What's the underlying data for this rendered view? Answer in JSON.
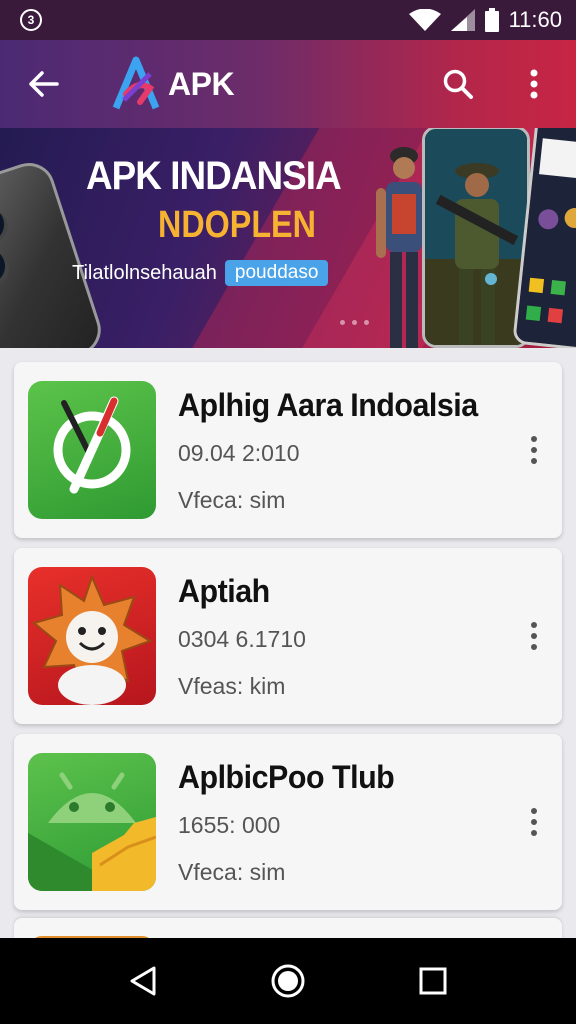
{
  "status_bar": {
    "time": "11:60",
    "notification_badge": "3"
  },
  "header": {
    "logo_text": "APK"
  },
  "banner": {
    "title": "APK INDANSIA",
    "subtitle": "NDOPLEN",
    "tagline": "Tilatlolnsehauah",
    "pill": "pouddaso"
  },
  "apps": [
    {
      "name": "Aplhig Aara Indoalsia",
      "meta": "09.04  2:010",
      "version": "Vfeca: sim",
      "icon": "pencil-circle-icon",
      "icon_color": "#3fae3a"
    },
    {
      "name": "Aptiah",
      "meta": "0304  6.1710",
      "version": "Vfeas: kim",
      "icon": "sun-face-icon",
      "icon_color": "#d8222a"
    },
    {
      "name": "AplbicPoo Tlub",
      "meta": "1655: 000",
      "version": "Vfeca: sim",
      "icon": "android-folder-icon",
      "icon_color": "#3fae3a"
    }
  ],
  "colors": {
    "accent_red": "#c82543",
    "accent_purple": "#4b2a74",
    "banner_gold": "#f6b331"
  }
}
